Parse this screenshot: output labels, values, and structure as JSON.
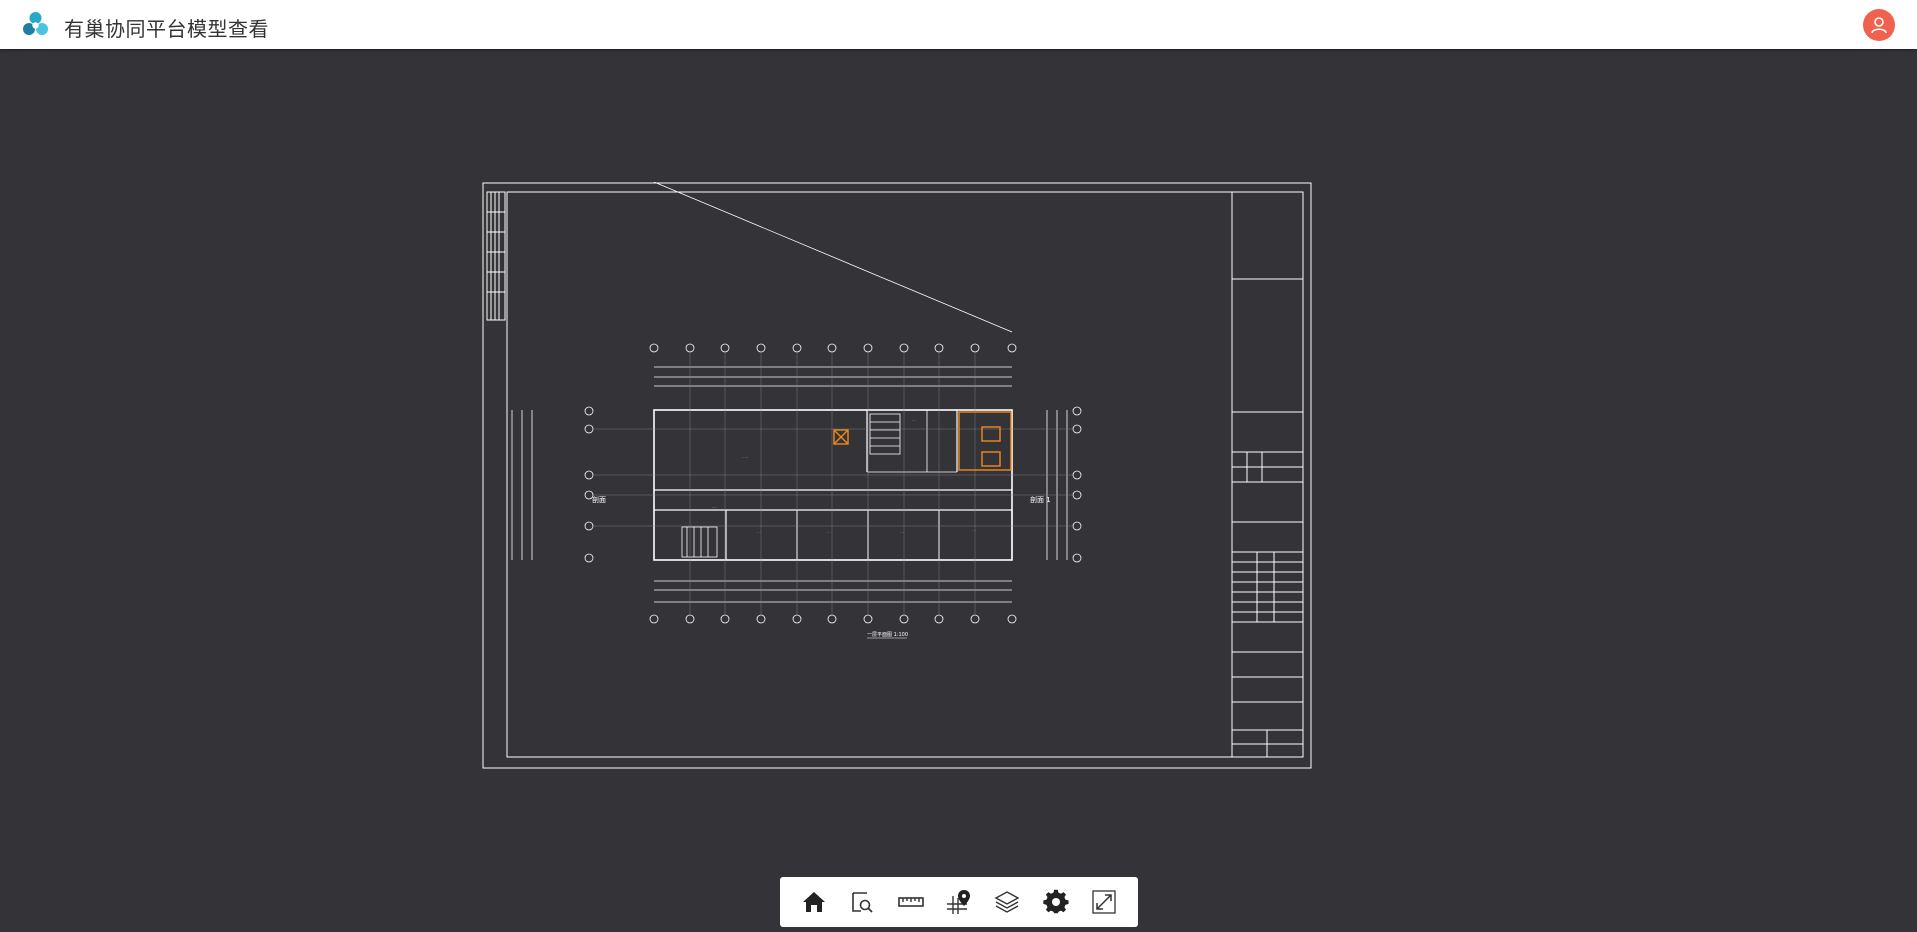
{
  "app": {
    "title": "有巢协同平台模型查看",
    "logo_icon": "app-logo-icon",
    "avatar_icon": "user-icon",
    "accent": "#29a8c9",
    "avatar_color": "#f0624e"
  },
  "drawing": {
    "title_caption": "一层平面图 1:100",
    "left_side_label": "剖面",
    "right_side_label": "剖面 1",
    "highlight_color": "#f08a1e",
    "line_color": "#ffffff",
    "room_text_color": "#2ecc40"
  },
  "toolbar": {
    "items": [
      {
        "name": "home",
        "icon": "home-icon"
      },
      {
        "name": "zoom-window",
        "icon": "zoom-window-icon"
      },
      {
        "name": "measure",
        "icon": "ruler-icon"
      },
      {
        "name": "location",
        "icon": "map-pin-icon"
      },
      {
        "name": "layers",
        "icon": "layers-icon"
      },
      {
        "name": "settings",
        "icon": "gear-icon"
      },
      {
        "name": "fullscreen",
        "icon": "fullscreen-icon"
      }
    ]
  }
}
